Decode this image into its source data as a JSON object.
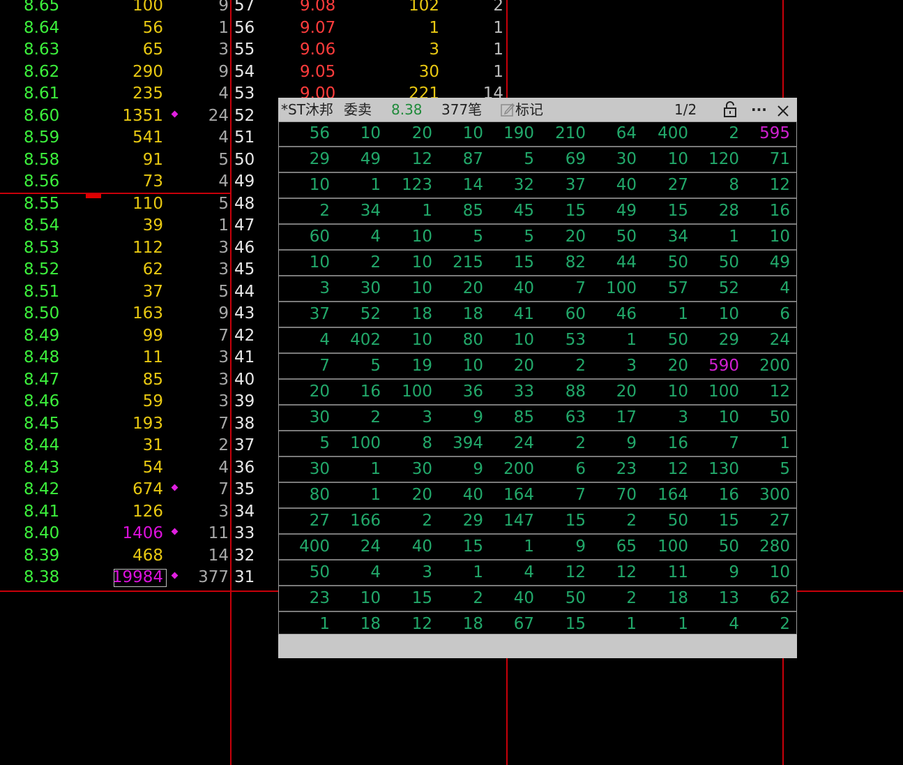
{
  "bids": [
    {
      "price": "8.65",
      "volume": "100",
      "count": "9",
      "idx": "57"
    },
    {
      "price": "8.64",
      "volume": "56",
      "count": "1",
      "idx": "56"
    },
    {
      "price": "8.63",
      "volume": "65",
      "count": "3",
      "idx": "55"
    },
    {
      "price": "8.62",
      "volume": "290",
      "count": "9",
      "idx": "54"
    },
    {
      "price": "8.61",
      "volume": "235",
      "count": "4",
      "idx": "53"
    },
    {
      "price": "8.60",
      "volume": "1351",
      "count": "24",
      "idx": "52",
      "mark": true
    },
    {
      "price": "8.59",
      "volume": "541",
      "count": "4",
      "idx": "51"
    },
    {
      "price": "8.58",
      "volume": "91",
      "count": "5",
      "idx": "50"
    },
    {
      "price": "8.56",
      "volume": "73",
      "count": "4",
      "idx": "49"
    },
    {
      "price": "8.55",
      "volume": "110",
      "count": "5",
      "idx": "48"
    },
    {
      "price": "8.54",
      "volume": "39",
      "count": "1",
      "idx": "47"
    },
    {
      "price": "8.53",
      "volume": "112",
      "count": "3",
      "idx": "46"
    },
    {
      "price": "8.52",
      "volume": "62",
      "count": "3",
      "idx": "45"
    },
    {
      "price": "8.51",
      "volume": "37",
      "count": "5",
      "idx": "44"
    },
    {
      "price": "8.50",
      "volume": "163",
      "count": "9",
      "idx": "43"
    },
    {
      "price": "8.49",
      "volume": "99",
      "count": "7",
      "idx": "42"
    },
    {
      "price": "8.48",
      "volume": "11",
      "count": "3",
      "idx": "41"
    },
    {
      "price": "8.47",
      "volume": "85",
      "count": "3",
      "idx": "40"
    },
    {
      "price": "8.46",
      "volume": "59",
      "count": "3",
      "idx": "39"
    },
    {
      "price": "8.45",
      "volume": "193",
      "count": "7",
      "idx": "38"
    },
    {
      "price": "8.44",
      "volume": "31",
      "count": "2",
      "idx": "37"
    },
    {
      "price": "8.43",
      "volume": "54",
      "count": "4",
      "idx": "36"
    },
    {
      "price": "8.42",
      "volume": "674",
      "count": "7",
      "idx": "35",
      "mark": true
    },
    {
      "price": "8.41",
      "volume": "126",
      "count": "3",
      "idx": "34"
    },
    {
      "price": "8.40",
      "volume": "1406",
      "count": "11",
      "idx": "33",
      "mark": true,
      "big": true
    },
    {
      "price": "8.39",
      "volume": "468",
      "count": "14",
      "idx": "32"
    },
    {
      "price": "8.38",
      "volume": "19984",
      "count": "377",
      "idx": "31",
      "mark": true,
      "big": true,
      "boxed": true
    }
  ],
  "asks": [
    {
      "price": "9.08",
      "volume": "102",
      "count": "2"
    },
    {
      "price": "9.07",
      "volume": "1",
      "count": "1"
    },
    {
      "price": "9.06",
      "volume": "3",
      "count": "1"
    },
    {
      "price": "9.05",
      "volume": "30",
      "count": "1"
    },
    {
      "price": "9.00",
      "volume": "221",
      "count": "14"
    }
  ],
  "popup": {
    "stock_name": "*ST沐邦",
    "side_label": "委卖",
    "price": "8.38",
    "orders_label": "377笔",
    "mark_label": "标记",
    "page": "1/2",
    "lock_icon": "unlock-icon",
    "more_icon": "ellipsis-icon",
    "close_icon": "close-icon",
    "accent_color": "#22a86a",
    "highlight_color": "#d020d0",
    "grid": [
      [
        "56",
        "10",
        "20",
        "10",
        "190",
        "210",
        "64",
        "400",
        "2",
        "595"
      ],
      [
        "29",
        "49",
        "12",
        "87",
        "5",
        "69",
        "30",
        "10",
        "120",
        "71"
      ],
      [
        "10",
        "1",
        "123",
        "14",
        "32",
        "37",
        "40",
        "27",
        "8",
        "12"
      ],
      [
        "2",
        "34",
        "1",
        "85",
        "45",
        "15",
        "49",
        "15",
        "28",
        "16"
      ],
      [
        "60",
        "4",
        "10",
        "5",
        "5",
        "20",
        "50",
        "34",
        "1",
        "10"
      ],
      [
        "10",
        "2",
        "10",
        "215",
        "15",
        "82",
        "44",
        "50",
        "50",
        "49"
      ],
      [
        "3",
        "30",
        "10",
        "20",
        "40",
        "7",
        "100",
        "57",
        "52",
        "4"
      ],
      [
        "37",
        "52",
        "18",
        "18",
        "41",
        "60",
        "46",
        "1",
        "10",
        "6"
      ],
      [
        "4",
        "402",
        "10",
        "80",
        "10",
        "53",
        "1",
        "50",
        "29",
        "24"
      ],
      [
        "7",
        "5",
        "19",
        "10",
        "20",
        "2",
        "3",
        "20",
        "590",
        "200"
      ],
      [
        "20",
        "16",
        "100",
        "36",
        "33",
        "88",
        "20",
        "10",
        "100",
        "12"
      ],
      [
        "30",
        "2",
        "3",
        "9",
        "85",
        "63",
        "17",
        "3",
        "10",
        "50"
      ],
      [
        "5",
        "100",
        "8",
        "394",
        "24",
        "2",
        "9",
        "16",
        "7",
        "1"
      ],
      [
        "30",
        "1",
        "30",
        "9",
        "200",
        "6",
        "23",
        "12",
        "130",
        "5"
      ],
      [
        "80",
        "1",
        "20",
        "40",
        "164",
        "7",
        "70",
        "164",
        "16",
        "300"
      ],
      [
        "27",
        "166",
        "2",
        "29",
        "147",
        "15",
        "2",
        "50",
        "15",
        "27"
      ],
      [
        "400",
        "24",
        "40",
        "15",
        "1",
        "9",
        "65",
        "100",
        "50",
        "280"
      ],
      [
        "50",
        "4",
        "3",
        "1",
        "4",
        "12",
        "12",
        "11",
        "9",
        "10"
      ],
      [
        "23",
        "10",
        "15",
        "2",
        "40",
        "50",
        "2",
        "18",
        "13",
        "62"
      ],
      [
        "1",
        "18",
        "12",
        "18",
        "67",
        "15",
        "1",
        "1",
        "4",
        "2"
      ]
    ],
    "highlighted": [
      "595",
      "590"
    ]
  }
}
